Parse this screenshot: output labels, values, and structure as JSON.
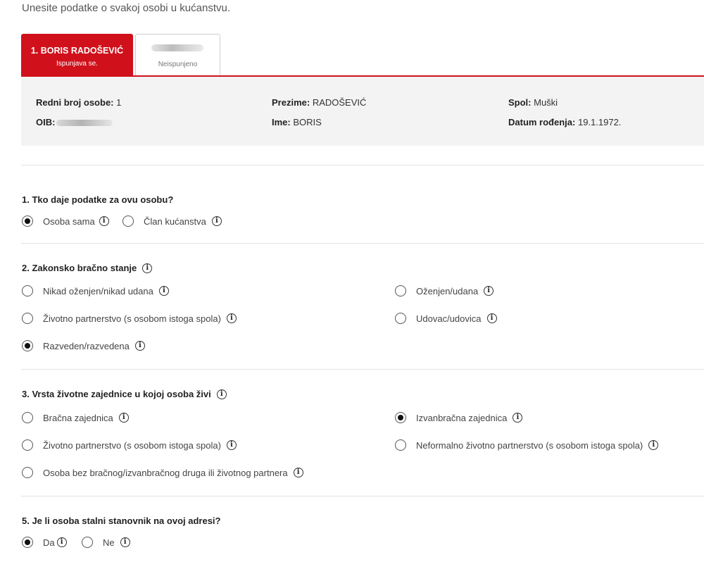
{
  "intro": "Unesite podatke o svakoj osobi u kućanstvu.",
  "tabs": [
    {
      "title": "1. BORIS RADOŠEVIĆ",
      "status": "Ispunjava se."
    },
    {
      "title": "",
      "status": "Neispunjeno"
    }
  ],
  "person": {
    "rb_label": "Redni broj osobe:",
    "rb_value": "1",
    "oib_label": "OIB:",
    "prezime_label": "Prezime:",
    "prezime_value": "RADOŠEVIĆ",
    "ime_label": "Ime:",
    "ime_value": "BORIS",
    "spol_label": "Spol:",
    "spol_value": "Muški",
    "datum_label": "Datum rođenja:",
    "datum_value": "19.1.1972."
  },
  "q1": {
    "title": "1. Tko daje podatke za ovu osobu?",
    "options": [
      {
        "label": "Osoba sama",
        "selected": true
      },
      {
        "label": "Član kućanstva",
        "selected": false
      }
    ]
  },
  "q2": {
    "title": "2. Zakonsko bračno stanje",
    "options": [
      {
        "label": "Nikad oženjen/nikad udana",
        "selected": false
      },
      {
        "label": "Oženjen/udana",
        "selected": false
      },
      {
        "label": "Životno partnerstvo (s osobom istoga spola)",
        "selected": false
      },
      {
        "label": "Udovac/udovica",
        "selected": false
      },
      {
        "label": "Razveden/razvedena",
        "selected": true
      }
    ]
  },
  "q3": {
    "title": "3. Vrsta životne zajednice u kojoj osoba živi",
    "options": [
      {
        "label": "Bračna zajednica",
        "selected": false
      },
      {
        "label": "Izvanbračna zajednica",
        "selected": true
      },
      {
        "label": "Životno partnerstvo (s osobom istoga spola)",
        "selected": false
      },
      {
        "label": "Neformalno životno partnerstvo (s osobom istoga spola)",
        "selected": false
      },
      {
        "label": "Osoba bez bračnog/izvanbračnog druga ili životnog partnera",
        "selected": false
      }
    ]
  },
  "q5": {
    "title": "5. Je li osoba stalni stanovnik na ovoj adresi?",
    "options": [
      {
        "label": "Da",
        "selected": true
      },
      {
        "label": "Ne",
        "selected": false
      }
    ]
  },
  "info_glyph": "i",
  "colors": {
    "accent": "#d0111b",
    "panel": "#f3f3f3"
  },
  "icons": {
    "info": "info-circle-icon",
    "radio": "radio-button"
  }
}
